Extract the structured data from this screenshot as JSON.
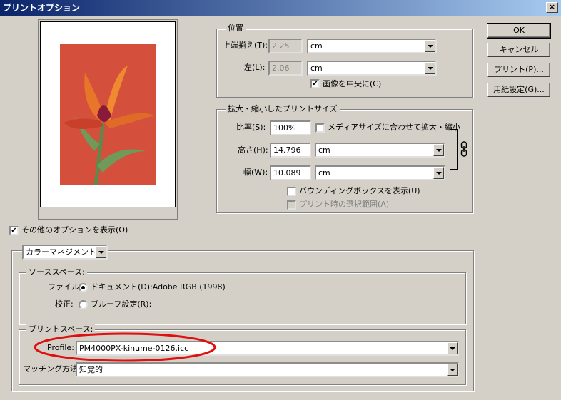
{
  "window": {
    "title": "プリントオプション",
    "close_label": "×"
  },
  "buttons": {
    "ok": "OK",
    "cancel": "キャンセル",
    "print": "プリント(P)...",
    "page_setup": "用紙設定(G)..."
  },
  "position": {
    "legend": "位置",
    "top_label": "上端揃え(T):",
    "top_value": "2.25",
    "top_unit": "cm",
    "left_label": "左(L):",
    "left_value": "2.06",
    "left_unit": "cm",
    "center_check_label": "画像を中央に(C)"
  },
  "scaled": {
    "legend": "拡大・縮小したプリントサイズ",
    "scale_label": "比率(S):",
    "scale_value": "100%",
    "fit_media_label": "メディアサイズに合わせて拡大・縮小",
    "height_label": "高さ(H):",
    "height_value": "14.796",
    "height_unit": "cm",
    "width_label": "幅(W):",
    "width_value": "10.089",
    "width_unit": "cm",
    "bbox_label": "バウンディングボックスを表示(U)",
    "selection_label": "プリント時の選択範囲(A)"
  },
  "more_options": {
    "label": "その他のオプションを表示(O)"
  },
  "color_mgmt": {
    "mode": "カラーマネジメント",
    "source_legend": "ソーススペース:",
    "file_label": "ファイル:",
    "file_option": "ドキュメント(D):Adobe RGB (1998)",
    "proof_label": "校正:",
    "proof_option": "プルーフ設定(R):",
    "print_legend": "プリントスペース:",
    "profile_label": "Profile:",
    "profile_value": "PM4000PX-kinume-0126.icc",
    "intent_label": "マッチング方法:",
    "intent_value": "知覚的"
  },
  "colors": {
    "highlight_ellipse": "#e01010",
    "titlebar_start": "#0a246a",
    "titlebar_end": "#a6caf0"
  }
}
